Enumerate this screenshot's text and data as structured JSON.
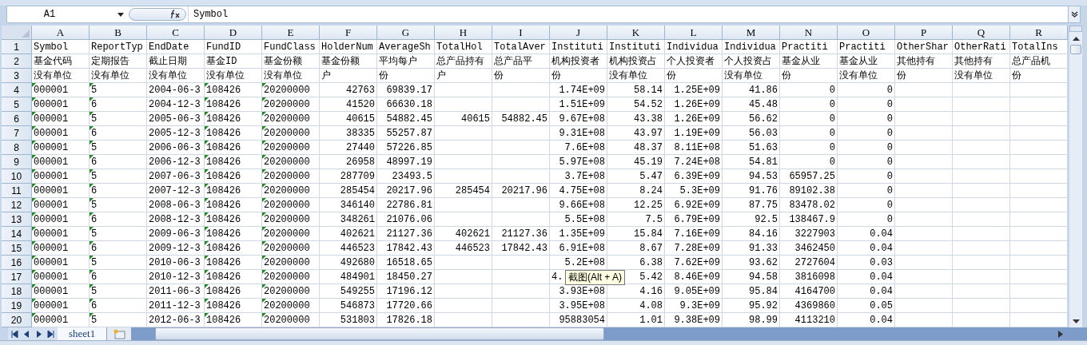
{
  "name_box": "A1",
  "formula": "Symbol",
  "columns": [
    {
      "letter": "A",
      "kind": "text",
      "flagged": true
    },
    {
      "letter": "B",
      "kind": "text",
      "flagged": true
    },
    {
      "letter": "C",
      "kind": "text",
      "flagged": false
    },
    {
      "letter": "D",
      "kind": "text",
      "flagged": true
    },
    {
      "letter": "E",
      "kind": "text",
      "flagged": true
    },
    {
      "letter": "F",
      "kind": "number",
      "flagged": false
    },
    {
      "letter": "G",
      "kind": "number",
      "flagged": false
    },
    {
      "letter": "H",
      "kind": "number",
      "flagged": false
    },
    {
      "letter": "I",
      "kind": "number",
      "flagged": false
    },
    {
      "letter": "J",
      "kind": "number",
      "flagged": false
    },
    {
      "letter": "K",
      "kind": "number",
      "flagged": false
    },
    {
      "letter": "L",
      "kind": "number",
      "flagged": false
    },
    {
      "letter": "M",
      "kind": "number",
      "flagged": false
    },
    {
      "letter": "N",
      "kind": "number",
      "flagged": false
    },
    {
      "letter": "O",
      "kind": "number",
      "flagged": false
    },
    {
      "letter": "P",
      "kind": "number",
      "flagged": false
    },
    {
      "letter": "Q",
      "kind": "number",
      "flagged": false
    },
    {
      "letter": "R",
      "kind": "number",
      "flagged": false
    }
  ],
  "rows": [
    {
      "number": "1",
      "kind": "header",
      "cells": [
        "Symbol",
        "ReportTyp",
        "EndDate",
        "FundID",
        "FundClass",
        "HolderNum",
        "AverageSh",
        "TotalHol",
        "TotalAver",
        "Instituti",
        "Instituti",
        "Individua",
        "Individua",
        "Practiti",
        "Practiti",
        "OtherShar",
        "OtherRati",
        "TotalIns"
      ]
    },
    {
      "number": "2",
      "kind": "header",
      "cells": [
        "基金代码",
        "定期报告",
        "截止日期",
        "基金ID",
        "基金份额",
        "基金份额",
        "平均每户",
        "总产品持有",
        "总产品平",
        "机构投资者",
        "机构投资占",
        "个人投资者",
        "个人投资占",
        "基金从业",
        "基金从业",
        "其他持有",
        "其他持有",
        "总产品机"
      ]
    },
    {
      "number": "3",
      "kind": "header",
      "cells": [
        "没有单位",
        "没有单位",
        "没有单位",
        "没有单位",
        "没有单位",
        "户",
        "份",
        "户",
        "份",
        "份",
        "没有单位",
        "份",
        "没有单位",
        "份",
        "没有单位",
        "份",
        "没有单位",
        "份"
      ]
    },
    {
      "number": "4",
      "kind": "data",
      "cells": [
        "000001",
        "5",
        "2004-06-3",
        "108426",
        "20200000",
        "42763",
        "69839.17",
        null,
        null,
        "1.74E+09",
        "58.14",
        "1.25E+09",
        "41.86",
        "0",
        "0"
      ]
    },
    {
      "number": "5",
      "kind": "data",
      "cells": [
        "000001",
        "6",
        "2004-12-3",
        "108426",
        "20200000",
        "41520",
        "66630.18",
        null,
        null,
        "1.51E+09",
        "54.52",
        "1.26E+09",
        "45.48",
        "0",
        "0"
      ]
    },
    {
      "number": "6",
      "kind": "data",
      "cells": [
        "000001",
        "5",
        "2005-06-3",
        "108426",
        "20200000",
        "40615",
        "54882.45",
        "40615",
        "54882.45",
        "9.67E+08",
        "43.38",
        "1.26E+09",
        "56.62",
        "0",
        "0"
      ]
    },
    {
      "number": "7",
      "kind": "data",
      "cells": [
        "000001",
        "6",
        "2005-12-3",
        "108426",
        "20200000",
        "38335",
        "55257.87",
        null,
        null,
        "9.31E+08",
        "43.97",
        "1.19E+09",
        "56.03",
        "0",
        "0"
      ]
    },
    {
      "number": "8",
      "kind": "data",
      "cells": [
        "000001",
        "5",
        "2006-06-3",
        "108426",
        "20200000",
        "27440",
        "57226.85",
        null,
        null,
        "7.6E+08",
        "48.37",
        "8.11E+08",
        "51.63",
        "0",
        "0"
      ]
    },
    {
      "number": "9",
      "kind": "data",
      "cells": [
        "000001",
        "6",
        "2006-12-3",
        "108426",
        "20200000",
        "26958",
        "48997.19",
        null,
        null,
        "5.97E+08",
        "45.19",
        "7.24E+08",
        "54.81",
        "0",
        "0"
      ]
    },
    {
      "number": "10",
      "kind": "data",
      "cells": [
        "000001",
        "5",
        "2007-06-3",
        "108426",
        "20200000",
        "287709",
        "23493.5",
        null,
        null,
        "3.7E+08",
        "5.47",
        "6.39E+09",
        "94.53",
        "65957.25",
        "0"
      ]
    },
    {
      "number": "11",
      "kind": "data",
      "cells": [
        "000001",
        "6",
        "2007-12-3",
        "108426",
        "20200000",
        "285454",
        "20217.96",
        "285454",
        "20217.96",
        "4.75E+08",
        "8.24",
        "5.3E+09",
        "91.76",
        "89102.38",
        "0"
      ]
    },
    {
      "number": "12",
      "kind": "data",
      "cells": [
        "000001",
        "5",
        "2008-06-3",
        "108426",
        "20200000",
        "346140",
        "22786.81",
        null,
        null,
        "9.66E+08",
        "12.25",
        "6.92E+09",
        "87.75",
        "83478.02",
        "0"
      ]
    },
    {
      "number": "13",
      "kind": "data",
      "cells": [
        "000001",
        "6",
        "2008-12-3",
        "108426",
        "20200000",
        "348261",
        "21076.06",
        null,
        null,
        "5.5E+08",
        "7.5",
        "6.79E+09",
        "92.5",
        "138467.9",
        "0"
      ]
    },
    {
      "number": "14",
      "kind": "data",
      "cells": [
        "000001",
        "5",
        "2009-06-3",
        "108426",
        "20200000",
        "402621",
        "21127.36",
        "402621",
        "21127.36",
        "1.35E+09",
        "15.84",
        "7.16E+09",
        "84.16",
        "3227903",
        "0.04"
      ]
    },
    {
      "number": "15",
      "kind": "data",
      "cells": [
        "000001",
        "6",
        "2009-12-3",
        "108426",
        "20200000",
        "446523",
        "17842.43",
        "446523",
        "17842.43",
        "6.91E+08",
        "8.67",
        "7.28E+09",
        "91.33",
        "3462450",
        "0.04"
      ]
    },
    {
      "number": "16",
      "kind": "data",
      "cells": [
        "000001",
        "5",
        "2010-06-3",
        "108426",
        "20200000",
        "492680",
        "16518.65",
        null,
        null,
        "5.2E+08",
        "6.38",
        "7.62E+09",
        "93.62",
        "2727604",
        "0.03"
      ]
    },
    {
      "number": "17",
      "kind": "data",
      "cells": [
        "000001",
        "6",
        "2010-12-3",
        "108426",
        "20200000",
        "484901",
        "18450.27",
        null,
        null,
        {
          "text": "4.",
          "tooltip": "截图(Alt + A)"
        },
        "5.42",
        "8.46E+09",
        "94.58",
        "3816098",
        "0.04"
      ]
    },
    {
      "number": "18",
      "kind": "data",
      "cells": [
        "000001",
        "5",
        "2011-06-3",
        "108426",
        "20200000",
        "549255",
        "17196.12",
        null,
        null,
        "3.93E+08",
        "4.16",
        "9.05E+09",
        "95.84",
        "4164700",
        "0.04"
      ]
    },
    {
      "number": "19",
      "kind": "data",
      "cells": [
        "000001",
        "6",
        "2011-12-3",
        "108426",
        "20200000",
        "546873",
        "17720.66",
        null,
        null,
        "3.95E+08",
        "4.08",
        "9.3E+09",
        "95.92",
        "4369860",
        "0.05"
      ]
    },
    {
      "number": "20",
      "kind": "data",
      "cells": [
        "000001",
        "5",
        "2012-06-3",
        "108426",
        "20200000",
        "531803",
        "17826.18",
        null,
        null,
        "95883054",
        "1.01",
        "9.38E+09",
        "98.99",
        "4113210",
        "0.04"
      ]
    }
  ],
  "sheet_tabs": [
    {
      "label": "sheet1",
      "selected": true
    }
  ]
}
